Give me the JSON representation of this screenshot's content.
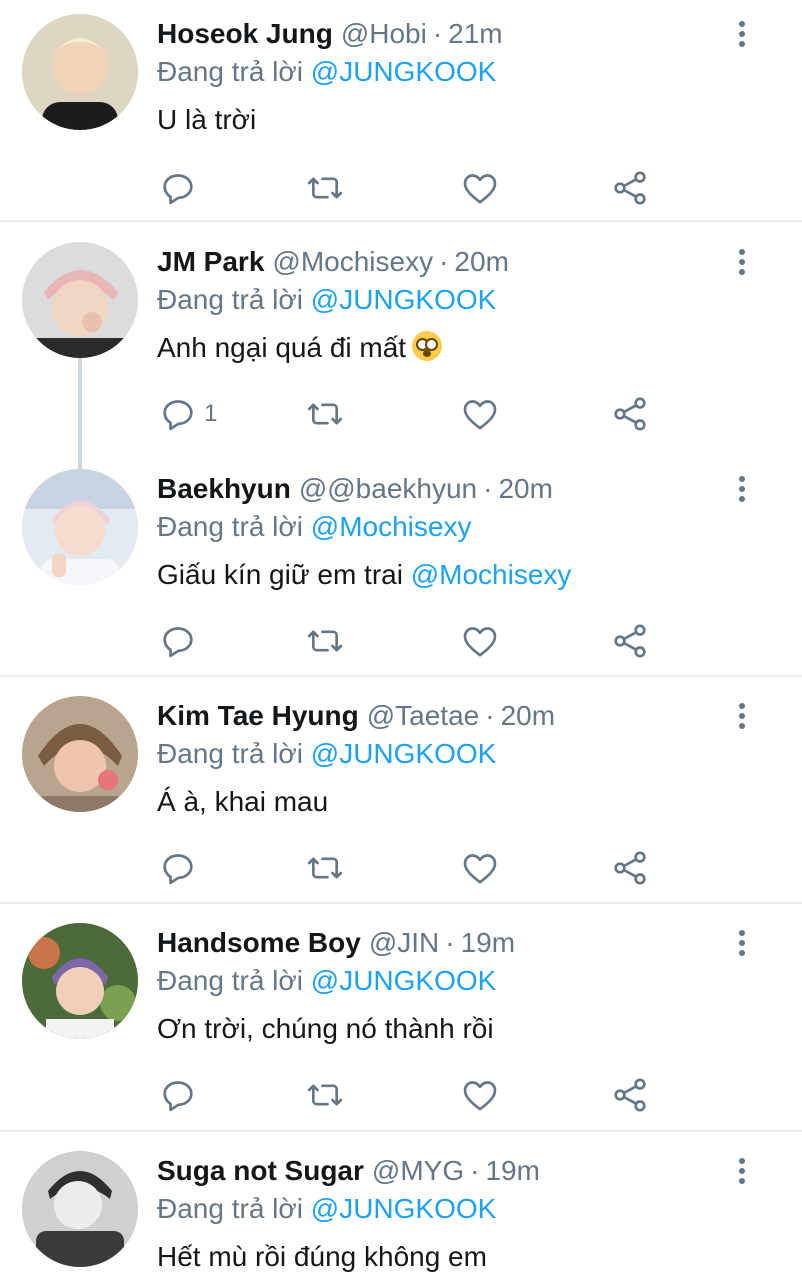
{
  "reply_prefix": "Đang trả lời",
  "tweets": [
    {
      "name": "Hoseok Jung",
      "handle": "@Hobi",
      "time": "21m",
      "reply_to": "@JUNGKOOK",
      "text": "U là trời",
      "reply_count": "",
      "avatar_colors": [
        "#f2e9c9",
        "#1c1c1c"
      ]
    },
    {
      "name": "JM Park",
      "handle": "@Mochisexy",
      "time": "20m",
      "reply_to": "@JUNGKOOK",
      "text": "Anh ngại quá đi mất",
      "emoji": "flushed-face",
      "reply_count": "1",
      "avatar_colors": [
        "#e8c7c0",
        "#2b2b2b"
      ]
    },
    {
      "name": "Baekhyun",
      "handle": "@@baekhyun",
      "time": "20m",
      "reply_to": "@Mochisexy",
      "text_prefix": "Giấu kín giữ em trai ",
      "text_mention": "@Mochisexy",
      "reply_count": "",
      "avatar_colors": [
        "#f3d9dd",
        "#dfe7f2"
      ]
    },
    {
      "name": "Kim Tae Hyung",
      "handle": "@Taetae",
      "time": "20m",
      "reply_to": "@JUNGKOOK",
      "text": "Á à, khai mau",
      "reply_count": "",
      "avatar_colors": [
        "#8a6a4e",
        "#f0c9b5"
      ]
    },
    {
      "name": "Handsome Boy",
      "handle": "@JIN",
      "time": "19m",
      "reply_to": "@JUNGKOOK",
      "text": "Ơn trời, chúng nó thành rồi",
      "reply_count": "",
      "avatar_colors": [
        "#6b5a8e",
        "#c9744a"
      ]
    },
    {
      "name": "Suga not Sugar",
      "handle": "@MYG",
      "time": "19m",
      "reply_to": "@JUNGKOOK",
      "text": "Hết mù rồi đúng không em",
      "reply_count": "",
      "avatar_colors": [
        "#3a3a3a",
        "#d8d8d8"
      ]
    }
  ],
  "colors": {
    "mention": "#1da1f2",
    "secondary": "#657786",
    "divider": "#e6ecf0",
    "thread_line": "#ccd6dd"
  },
  "icons": {
    "reply": "reply-icon",
    "retweet": "retweet-icon",
    "like": "heart-icon",
    "share": "share-icon",
    "more": "more-vertical-icon"
  }
}
